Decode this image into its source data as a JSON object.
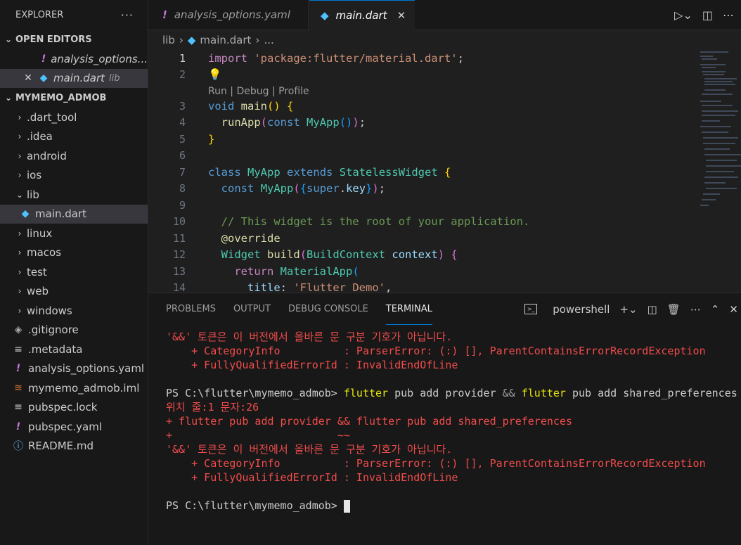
{
  "sidebar": {
    "title": "EXPLORER",
    "more": "···",
    "open_editors": {
      "label": "OPEN EDITORS",
      "items": [
        {
          "name": "analysis_options..."
        },
        {
          "name": "main.dart",
          "desc": "lib"
        }
      ]
    },
    "project": {
      "label": "MYMEMO_ADMOB",
      "folders": [
        ".dart_tool",
        ".idea",
        "android",
        "ios",
        "lib"
      ],
      "lib_child": "main.dart",
      "folders2": [
        "linux",
        "macos",
        "test",
        "web",
        "windows"
      ],
      "files": [
        ".gitignore",
        ".metadata",
        "analysis_options.yaml",
        "mymemo_admob.iml",
        "pubspec.lock",
        "pubspec.yaml",
        "README.md"
      ]
    }
  },
  "tabs": {
    "tab1": "analysis_options.yaml",
    "tab2": "main.dart"
  },
  "breadcrumb": {
    "folder": "lib",
    "file": "main.dart",
    "more": "..."
  },
  "editor": {
    "codelens": "Run | Debug | Profile",
    "line_numbers": [
      "1",
      "2",
      "3",
      "4",
      "5",
      "6",
      "7",
      "8",
      "9",
      "10",
      "11",
      "12",
      "13",
      "14"
    ]
  },
  "panel": {
    "tabs": [
      "PROBLEMS",
      "OUTPUT",
      "DEBUG CONSOLE",
      "TERMINAL"
    ],
    "shell": "powershell"
  },
  "terminal": {
    "l1": "'&&' 토큰은 이 버전에서 올바른 문 구분 기호가 아닙니다.",
    "l2": "    + CategoryInfo          : ParserError: (:) [], ParentContainsErrorRecordException",
    "l3": "    + FullyQualifiedErrorId : InvalidEndOfLine",
    "prompt1": "PS C:\\flutter\\mymemo_admob> ",
    "cmd_a": "flutter",
    "cmd_b": " pub add provider ",
    "cmd_c": "&&",
    "cmd_d": " flutter",
    "cmd_e": " pub add shared_preferences",
    "l5": "위치 줄:1 문자:26",
    "l6": "+ flutter pub add provider && flutter pub add shared_preferences",
    "l7": "+                          ~~",
    "l8": "'&&' 토큰은 이 버전에서 올바른 문 구분 기호가 아닙니다.",
    "l9": "    + CategoryInfo          : ParserError: (:) [], ParentContainsErrorRecordException",
    "l10": "    + FullyQualifiedErrorId : InvalidEndOfLine",
    "prompt2": "PS C:\\flutter\\mymemo_admob> "
  }
}
